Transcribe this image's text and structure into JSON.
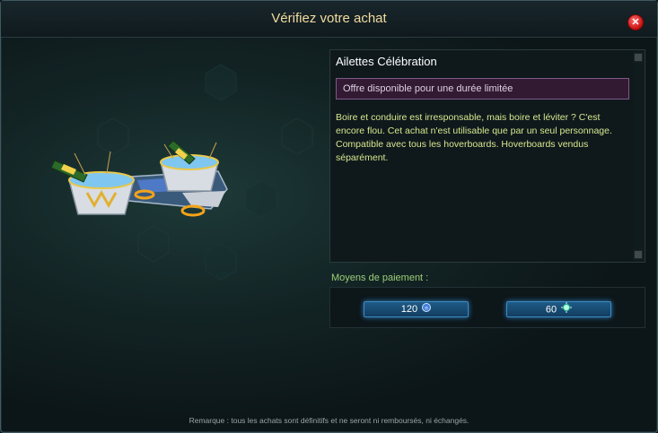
{
  "dialog": {
    "title": "Vérifiez votre achat",
    "close_icon": "close-icon"
  },
  "item": {
    "name": "Ailettes Célébration",
    "offer_badge": "Offre disponible pour une durée limitée",
    "description": "Boire et conduire est irresponsable, mais boire et léviter ? C'est encore flou. Cet achat n'est utilisable que par un seul personnage. Compatible avec tous les hoverboards. Hoverboards vendus séparément."
  },
  "payment": {
    "label": "Moyens de paiement :",
    "options": [
      {
        "amount": "120",
        "currency_icon": "premium-currency-icon"
      },
      {
        "amount": "60",
        "currency_icon": "omnibits-currency-icon"
      }
    ]
  },
  "footer": {
    "note": "Remarque : tous les achats sont définitifs et ne seront ni remboursés, ni échangés."
  },
  "colors": {
    "title": "#f2dc9d",
    "description": "#d7e78e",
    "payment_label": "#9ccd76",
    "button": "#1f5b86"
  }
}
